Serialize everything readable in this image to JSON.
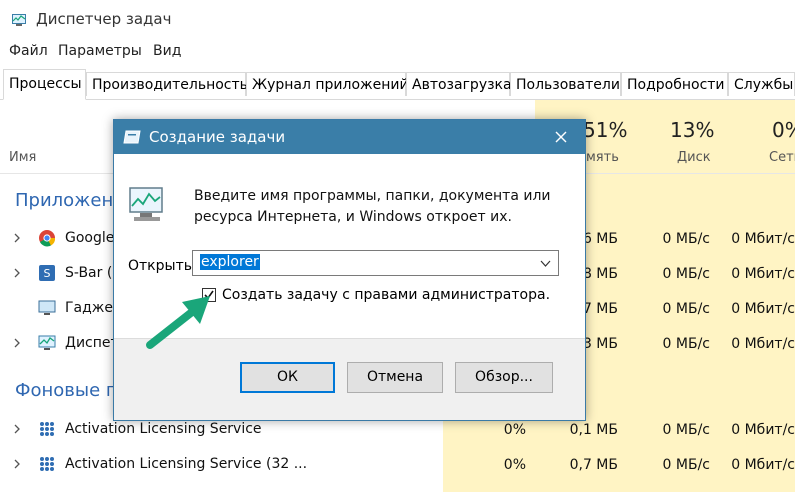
{
  "window": {
    "title": "Диспетчер задач"
  },
  "menu": [
    "Файл",
    "Параметры",
    "Вид"
  ],
  "tabs": [
    "Процессы",
    "Производительность",
    "Журнал приложений",
    "Автозагрузка",
    "Пользователи",
    "Подробности",
    "Службы"
  ],
  "columns": {
    "name": "Имя",
    "memory": {
      "pct": "51%",
      "label": "мять"
    },
    "disk": {
      "pct": "13%",
      "label": "Диск"
    },
    "network": {
      "pct": "0%",
      "label": "Сеть"
    }
  },
  "groups": {
    "apps": "Приложен",
    "background": "Фоновые п"
  },
  "rows": [
    {
      "name": "Google",
      "memory": "6 МБ",
      "disk": "0 МБ/с",
      "network": "0 Мбит/с"
    },
    {
      "name": "S-Bar (",
      "memory": "8 МБ",
      "disk": "0 МБ/с",
      "network": "0 Мбит/с"
    },
    {
      "name": "Гаджет",
      "memory": "7 МБ",
      "disk": "0 МБ/с",
      "network": "0 Мбит/с"
    },
    {
      "name": "Диспет",
      "memory": "3 МБ",
      "disk": "0 МБ/с",
      "network": "0 Мбит/с"
    },
    {
      "name": "Activation Licensing Service",
      "cpu": "0%",
      "memory": "0,1 МБ",
      "disk": "0 МБ/с",
      "network": "0 Мбит/с"
    },
    {
      "name": "Activation Licensing Service (32 ...",
      "cpu": "0%",
      "memory": "0,7 МБ",
      "disk": "0 МБ/с",
      "network": "0 Мбит/с"
    }
  ],
  "dialog": {
    "title": "Создание задачи",
    "description": "Введите имя программы, папки, документа или ресурса Интернета, и Windows откроет их.",
    "open_label": "Открыть:",
    "input_value": "explorer",
    "checkbox_label": "Создать задачу с правами администратора.",
    "checkbox_checked": true,
    "ok": "ОК",
    "cancel": "Отмена",
    "browse": "Обзор..."
  },
  "colors": {
    "accent": "#0078d7",
    "dialog_title": "#3a7ea8",
    "group_title": "#2f67b1",
    "heat": "#fff4c4",
    "arrow": "#1aa67a"
  }
}
